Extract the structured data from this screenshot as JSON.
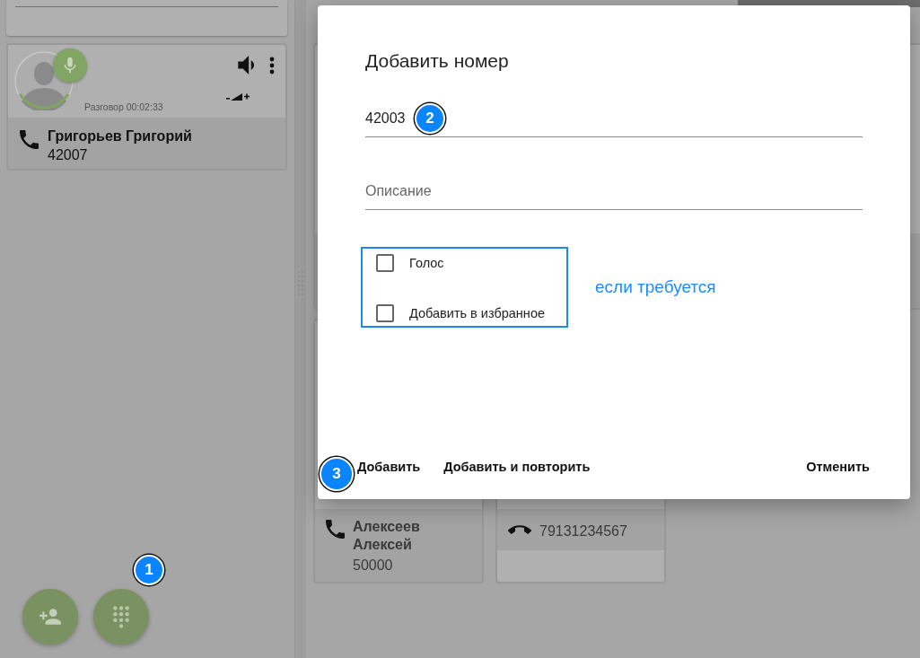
{
  "left_panel": {
    "call_card": {
      "status": "Разговор 00:02:33",
      "name": "Григорьев Григорий",
      "number": "42007",
      "kind": "connected"
    }
  },
  "main_cards": [
    {
      "kind": "connected",
      "name": "Алексеев Алексей",
      "number": "50000"
    },
    {
      "kind": "hangup",
      "number": "79131234567"
    }
  ],
  "fab_buttons": [
    {
      "kind": "add-contact"
    },
    {
      "kind": "dialpad",
      "marker": "1"
    }
  ],
  "dialog": {
    "title": "Добавить номер",
    "number_field": {
      "value": "42003",
      "marker": "2"
    },
    "description_field": {
      "placeholder": "Описание"
    },
    "checkboxes": [
      {
        "label": "Голос",
        "checked": false
      },
      {
        "label": "Добавить в избранное",
        "checked": false
      }
    ],
    "highlight_note": "если требуется",
    "buttons": [
      "Добавить",
      "Добавить и повторить"
    ],
    "actions_marker": "3",
    "cancel_button": "Отменить"
  }
}
